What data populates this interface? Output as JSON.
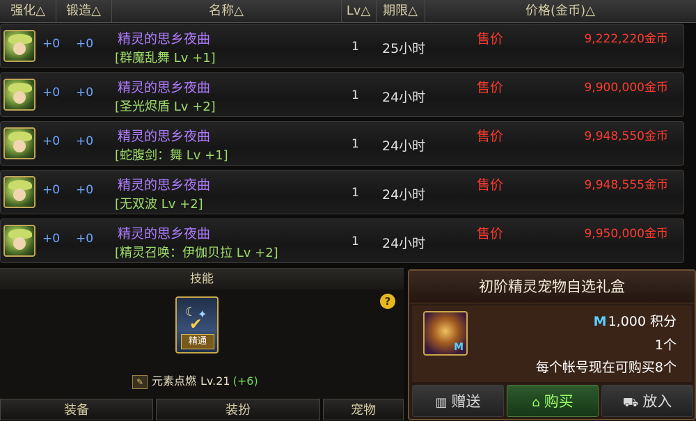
{
  "header": {
    "cols": [
      "强化△",
      "锻造△",
      "名称△",
      "Lv△",
      "期限△",
      "价格(金币)△"
    ]
  },
  "listings": [
    {
      "enhance": "+0",
      "forge": "+0",
      "name": "精灵的思乡夜曲",
      "skill": "[群魔乱舞 Lv +1]",
      "lv": "1",
      "period": "25小时",
      "sell_label": "售价",
      "price": "9,222,220金币"
    },
    {
      "enhance": "+0",
      "forge": "+0",
      "name": "精灵的思乡夜曲",
      "skill": "[圣光烬盾 Lv +2]",
      "lv": "1",
      "period": "24小时",
      "sell_label": "售价",
      "price": "9,900,000金币"
    },
    {
      "enhance": "+0",
      "forge": "+0",
      "name": "精灵的思乡夜曲",
      "skill": "[蛇腹剑：舞 Lv +1]",
      "lv": "1",
      "period": "24小时",
      "sell_label": "售价",
      "price": "9,948,550金币"
    },
    {
      "enhance": "+0",
      "forge": "+0",
      "name": "精灵的思乡夜曲",
      "skill": "[无双波 Lv +2]",
      "lv": "1",
      "period": "24小时",
      "sell_label": "售价",
      "price": "9,948,555金币"
    },
    {
      "enhance": "+0",
      "forge": "+0",
      "name": "精灵的思乡夜曲",
      "skill": "[精灵召唤：伊伽贝拉 Lv +2]",
      "lv": "1",
      "period": "24小时",
      "sell_label": "售价",
      "price": "9,950,000金币"
    }
  ],
  "skill_panel": {
    "title": "技能",
    "icon_tag": "精通",
    "help_glyph": "?",
    "skill_name": "元素点燃",
    "skill_level": "Lv.21",
    "skill_bonus": "(+6)"
  },
  "tabs": [
    "装备",
    "装扮",
    "宠物"
  ],
  "product": {
    "title": "初阶精灵宠物自选礼盒",
    "points_mark": "M",
    "points": "1,000 积分",
    "count": "1个",
    "limit": "每个帐号现在可购买8个",
    "icon_mark": "M",
    "buttons": {
      "gift": "赠送",
      "buy": "购买",
      "cart": "放入"
    }
  },
  "icons": [
    "item-elf-icon",
    "skill-mastery-icon",
    "help-icon",
    "gift-icon",
    "buy-icon",
    "cart-icon",
    "pet-box-icon"
  ],
  "colors": {
    "item_name": "#b07cff",
    "skill_text": "#9fdc6a",
    "price": "#ff3b2f",
    "enhance": "#6fa6ff"
  }
}
